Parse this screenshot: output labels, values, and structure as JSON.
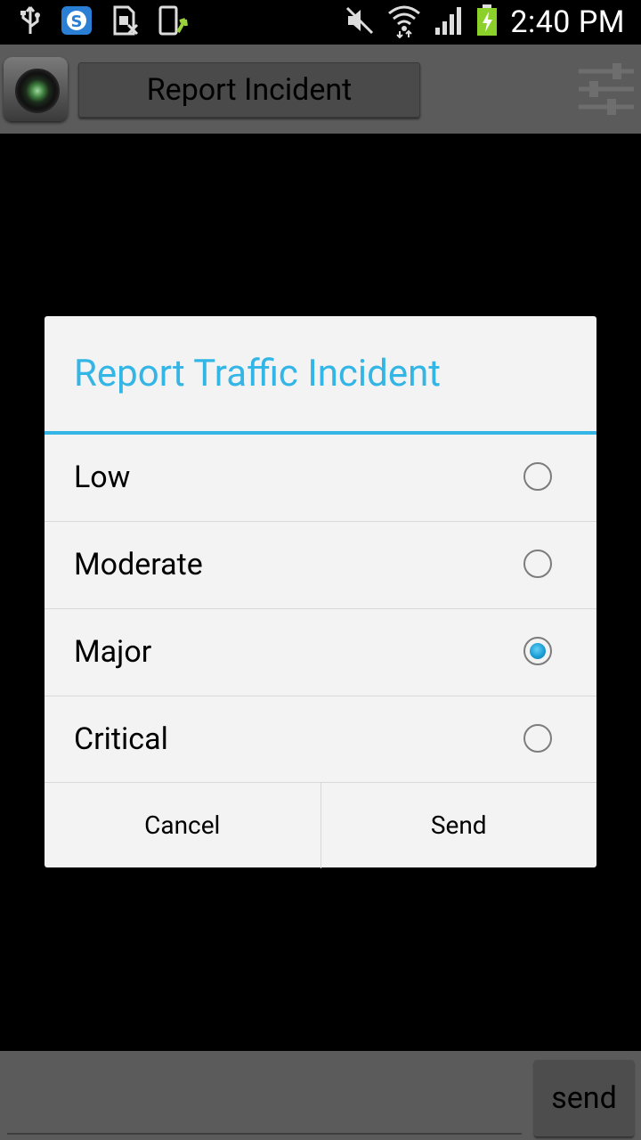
{
  "status_bar": {
    "time": "2:40 PM",
    "icons": [
      "usb-icon",
      "skype-icon",
      "sim-icon",
      "phone-transfer-icon",
      "mute-icon",
      "wifi-icon",
      "signal-icon",
      "battery-charging-icon"
    ]
  },
  "action_bar": {
    "title": "Report Incident",
    "camera_icon": "camera-icon",
    "settings_icon": "sliders-icon"
  },
  "dialog": {
    "title": "Report Traffic Incident",
    "accent_color": "#33b5e5",
    "options": [
      {
        "label": "Low",
        "checked": false
      },
      {
        "label": "Moderate",
        "checked": false
      },
      {
        "label": "Major",
        "checked": true
      },
      {
        "label": "Critical",
        "checked": false
      }
    ],
    "cancel_label": "Cancel",
    "send_label": "Send"
  },
  "bottom_bar": {
    "input_value": "",
    "send_label": "send"
  }
}
